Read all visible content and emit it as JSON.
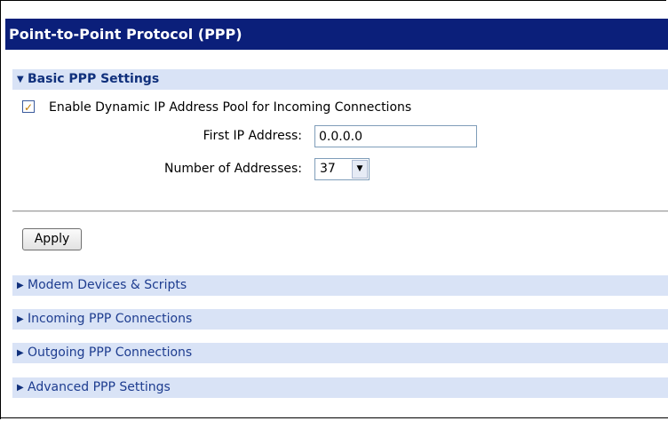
{
  "page": {
    "title": "Point-to-Point Protocol (PPP)"
  },
  "basic_section": {
    "label": "Basic PPP Settings",
    "expanded": true,
    "dynamic_pool_checkbox": {
      "label": "Enable Dynamic IP Address Pool for Incoming Connections",
      "checked": true
    },
    "first_ip": {
      "label": "First IP Address:",
      "value": "0.0.0.0"
    },
    "num_addresses": {
      "label": "Number of Addresses:",
      "value": "37"
    }
  },
  "apply_button": {
    "label": "Apply"
  },
  "collapsed_sections": [
    {
      "label": "Modem Devices & Scripts"
    },
    {
      "label": "Incoming PPP Connections"
    },
    {
      "label": "Outgoing PPP Connections"
    },
    {
      "label": "Advanced PPP Settings"
    }
  ],
  "icons": {
    "expanded": "triangle-down-icon",
    "collapsed": "triangle-right-icon",
    "dropdown": "chevron-down-icon",
    "checkmark": "checkmark-icon"
  },
  "colors": {
    "title_bg": "#0b1f7a",
    "section_bg": "#d9e3f6",
    "section_text": "#10307c"
  }
}
